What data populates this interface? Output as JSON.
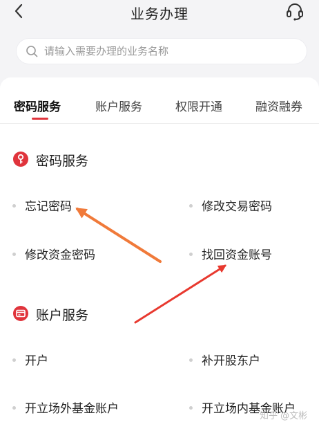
{
  "header": {
    "title": "业务办理",
    "back_icon": "chevron-left-icon",
    "service_icon": "headset-icon"
  },
  "search": {
    "placeholder": "请输入需要办理的业务名称",
    "value": ""
  },
  "tabs": [
    {
      "label": "密码服务",
      "active": true
    },
    {
      "label": "账户服务",
      "active": false
    },
    {
      "label": "权限开通",
      "active": false
    },
    {
      "label": "融资融券",
      "active": false
    }
  ],
  "sections": [
    {
      "title": "密码服务",
      "icon": "key-icon",
      "items": [
        "忘记密码",
        "修改交易密码",
        "修改资金密码",
        "找回资金账号"
      ]
    },
    {
      "title": "账户服务",
      "icon": "card-icon",
      "items": [
        "开户",
        "补开股东户",
        "开立场外基金账户",
        "开立场内基金账户"
      ]
    }
  ],
  "watermark": "知乎 @文彬",
  "colors": {
    "accent": "#e0343c",
    "header_bg": "#f4f4f6",
    "arrow": "#f07a3a"
  }
}
